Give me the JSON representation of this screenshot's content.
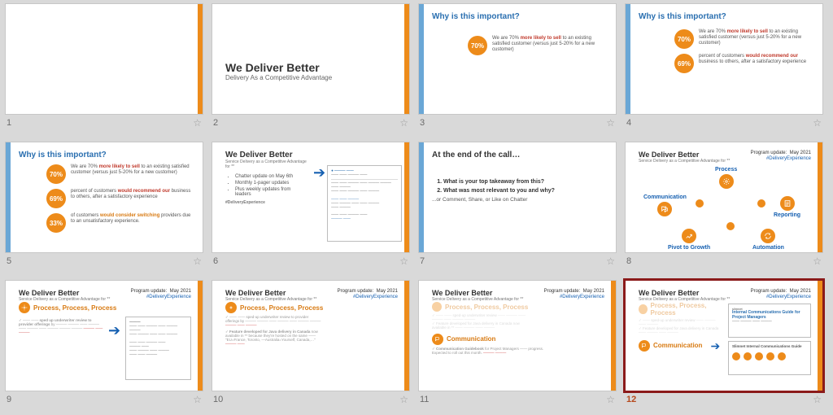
{
  "slides": [
    {
      "num": "1"
    },
    {
      "num": "2",
      "title": "We Deliver Better",
      "sub": "Delivery As a Competitive Advantage"
    },
    {
      "num": "3",
      "heading": "Why is this important?",
      "pc1": "70%",
      "t1a": "We are 70% ",
      "t1b": "more likely to sell",
      "t1c": " to an existing satisfied customer (versus just 5-20% for a new customer)"
    },
    {
      "num": "4",
      "heading": "Why is this important?",
      "pc1": "70%",
      "t1a": "We are 70% ",
      "t1b": "more likely to sell",
      "t1c": " to an existing satisfied customer (versus just 5-20% for a new customer)",
      "pc2": "69%",
      "t2a": "percent of customers ",
      "t2b": "would recommend our",
      "t2c": " business to others, after a satisfactory experience"
    },
    {
      "num": "5",
      "heading": "Why is this important?",
      "pc1": "70%",
      "t1a": "We are 70% ",
      "t1b": "more likely to sell",
      "t1c": " to an existing satisfied customer (versus just 5-20% for a new customer)",
      "pc2": "69%",
      "t2a": "percent of customers ",
      "t2b": "would recommend our",
      "t2c": " business to others, after a satisfactory experience",
      "pc3": "33%",
      "t3a": "of customers ",
      "t3b": "would consider switching",
      "t3c": " providers due to an unsatisfactory experience."
    },
    {
      "num": "6",
      "heading": "We Deliver Better",
      "sub": "Service Delivery as a Competitive Advantage for **",
      "b1": "Chatter update on May 6th",
      "b2": "Monthly 1-pager updates",
      "b3": "Plus weekly updates from leaders",
      "hash": "#DeliveryExperience"
    },
    {
      "num": "7",
      "heading": "At the end of the call…",
      "q1": "What is your top takeaway from this?",
      "q2": "What was most relevant to you and why?",
      "hint": "...or Comment, Share, or Like on Chatter"
    },
    {
      "num": "8",
      "heading": "We Deliver Better",
      "sub": "Service Delivery as a Competitive Advantage for **",
      "ptagA": "Program update:",
      "ptagB": "May 2021",
      "hash": "#DeliveryExperience",
      "l1": "Process",
      "l2": "Communication",
      "l3": "Reporting",
      "l4": "Pivot to Growth",
      "l5": "Automation"
    },
    {
      "num": "9",
      "heading": "We Deliver Better",
      "sub": "Service Delivery as a Competitive Advantage for **",
      "ptagA": "Program update:",
      "ptagB": "May 2021",
      "hash": "#DeliveryExperience",
      "sect": "Process, Process, Process"
    },
    {
      "num": "10",
      "heading": "We Deliver Better",
      "sub": "Service Delivery as a Competitive Advantage for **",
      "ptagA": "Program update:",
      "ptagB": "May 2021",
      "hash": "#DeliveryExperience",
      "sect": "Process, Process, Process"
    },
    {
      "num": "11",
      "heading": "We Deliver Better",
      "sub": "Service Delivery as a Competitive Advantage for **",
      "ptagA": "Program update:",
      "ptagB": "May 2021",
      "hash": "#DeliveryExperience",
      "sect": "Process, Process, Process",
      "sect2": "Communication"
    },
    {
      "num": "12",
      "heading": "We Deliver Better",
      "sub": "Service Delivery as a Competitive Advantage for **",
      "ptagA": "Program update:",
      "ptagB": "May 2021",
      "hash": "#DeliveryExperience",
      "sect": "Process, Process, Process",
      "sect2": "Communication",
      "docTitle": "Internal Communications Guide for Project Managers"
    }
  ]
}
